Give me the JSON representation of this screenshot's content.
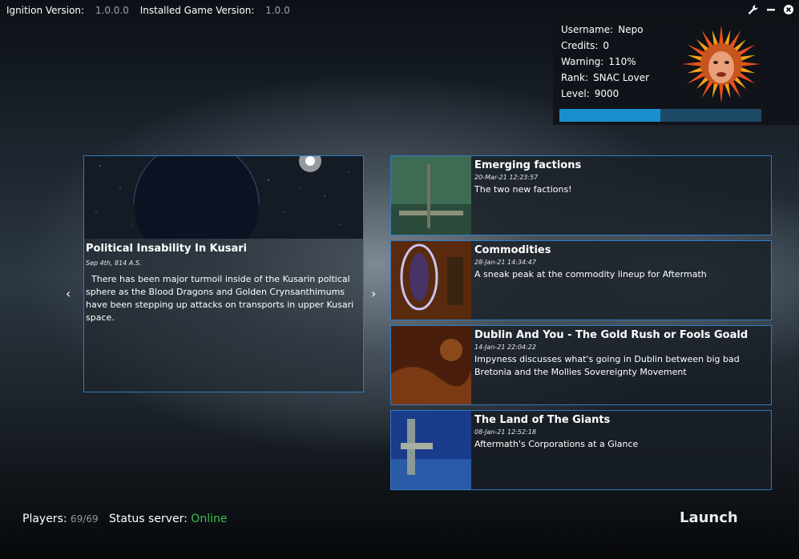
{
  "versions": {
    "ignition_label": "Ignition Version:",
    "ignition_value": "1.0.0.0",
    "installed_label": "Installed Game Version:",
    "installed_value": "1.0.0"
  },
  "window_controls": [
    "wrench-icon",
    "minimize-icon",
    "close-icon"
  ],
  "user": {
    "username_label": "Username:",
    "username": "Nepo",
    "credits_label": "Credits:",
    "credits": "0",
    "warning_label": "Warning:",
    "warning": "110%",
    "rank_label": "Rank:",
    "rank": "SNAC Lover",
    "level_label": "Level:",
    "level": "9000",
    "xp_progress": 0.5
  },
  "featured": {
    "title": "Political Insability In Kusari",
    "date": "Sep 4th, 814 A.S.",
    "body": "  There has been major turmoil inside of the Kusarin poltical sphere as the Blood Dragons and Golden Crynsanthimums have been stepping up attacks on transports in upper Kusari space."
  },
  "nav": {
    "prev": "‹",
    "next": "›"
  },
  "news": [
    {
      "title": "Emerging factions",
      "date": "20-Mar-21 12:23:57",
      "body": "The two new factions!"
    },
    {
      "title": "Commodities",
      "date": "28-Jan-21 14:34:47",
      "body": "A sneak peak at the commodity lineup for Aftermath"
    },
    {
      "title": "Dublin And You - The Gold Rush or Fools Goald",
      "date": "14-Jan-21 22:04:22",
      "body": "Impyness discusses what's going in Dublin between big bad Bretonia and the Mollies Sovereignty Movement"
    },
    {
      "title": "The Land of The Giants",
      "date": "08-Jan-21 12:52:18",
      "body": "Aftermath's Corporations at a Glance"
    }
  ],
  "footer": {
    "players_label": "Players:",
    "players_value": "69/69",
    "status_label": "Status server:",
    "status_value": "Online"
  },
  "launch_label": "Launch",
  "colors": {
    "accent": "#1a8fd0",
    "border": "#2f7cc4",
    "online": "#3bc24a"
  }
}
